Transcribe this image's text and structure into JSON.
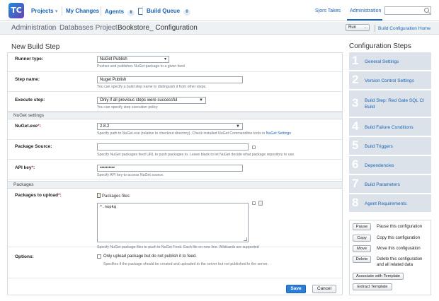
{
  "logo": {
    "text": "TC"
  },
  "nav": {
    "projects": "Projects",
    "my_changes": "My Changes",
    "agents": "Agents",
    "agents_count": "8",
    "build_queue": "Build Queue",
    "build_queue_count": "0",
    "user": "Sjors Takes",
    "admin": "Administration",
    "search_placeholder": ""
  },
  "breadcrumb": {
    "admin": "Administration",
    "project": "Databases Project",
    "current": "Bookstore_ Configuration",
    "run": "Run",
    "run_more": "...",
    "home": "Build Configuration Home"
  },
  "form": {
    "title": "New Build Step",
    "runner_type_label": "Runner type:",
    "runner_type_value": "NuGet Publish",
    "runner_type_hint": "Pushes and publishes NuGet package to a given feed",
    "step_name_label": "Step name:",
    "step_name_value": "Nuget Publish",
    "step_name_hint": "You can specify a build step name to distinguish it from other steps.",
    "execute_label": "Execute step:",
    "execute_value": "Only if all previous steps were successful",
    "execute_hint": "You can specify step execution policy",
    "nuget_section": "NuGet settings",
    "nuget_exe_label": "NuGet.exe",
    "nuget_exe_value": "2.8.2",
    "nuget_exe_hint": "Specify path to NuGet.exe (relative to checkout directory). Check installed NuGet Commandline tools in ",
    "nuget_exe_hint_link": "NuGet Settings",
    "source_label": "Package Source:",
    "source_value": "",
    "source_hint": "Specify NuGet packages feed URL to push packages to. Leave blank to let NuGet decide what package repository to use.",
    "api_key_label": "API key",
    "api_key_value": "••••••••••",
    "api_key_hint": "Specify API key to access NuGet source.",
    "packages_section": "Packages",
    "packages_label": "Packages to upload",
    "packages_files_label": "Packages files:",
    "packages_value": "*.nupkg",
    "packages_hint": "Specify NuGet package files to push to NuGet Feed. Each file on new line. Wildcards are supported",
    "options_label": "Options:",
    "options_checkbox": "Only upload package but do not publish it to feed.",
    "options_hint": "Specifies if the package should be created and uploaded to the server but not published to the server.",
    "required_mark": "*",
    "colon": ":",
    "save": "Save",
    "cancel": "Cancel"
  },
  "config_steps": {
    "title": "Configuration Steps",
    "items": [
      {
        "num": "1",
        "label": "General Settings"
      },
      {
        "num": "2",
        "label": "Version Control Settings"
      },
      {
        "num": "3",
        "label": "Build Step: Red Gate SQL CI Build"
      },
      {
        "num": "4",
        "label": "Build Failure Conditions"
      },
      {
        "num": "5",
        "label": "Build Triggers"
      },
      {
        "num": "6",
        "label": "Dependencies"
      },
      {
        "num": "7",
        "label": "Build Parameters"
      },
      {
        "num": "8",
        "label": "Agent Requirements"
      }
    ]
  },
  "actions": {
    "pause": "Pause",
    "pause_desc": "Pause this configuration",
    "copy": "Copy",
    "copy_desc": "Copy this configuration",
    "move": "Move",
    "move_desc": "Move this configuration",
    "delete": "Delete",
    "delete_desc": "Delete this configuration and all related data",
    "associate": "Associate with Template",
    "extract": "Extract Template"
  }
}
